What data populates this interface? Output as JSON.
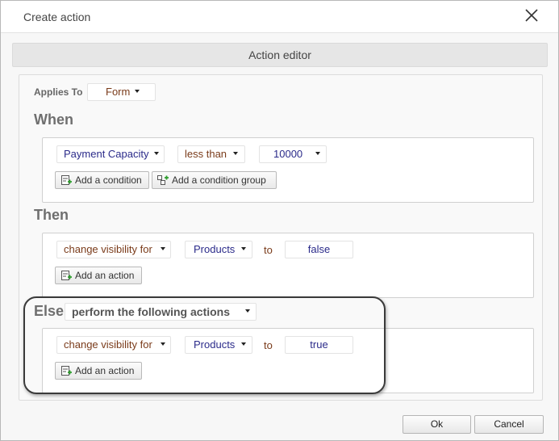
{
  "window": {
    "title": "Create action"
  },
  "editor": {
    "header": "Action editor",
    "applies_to": {
      "label": "Applies To",
      "value": "Form"
    }
  },
  "when": {
    "title": "When",
    "condition": {
      "field": "Payment Capacity",
      "operator": "less than",
      "value": "10000"
    },
    "add_condition_label": "Add a condition",
    "add_condition_group_label": "Add a condition group"
  },
  "then": {
    "title": "Then",
    "action": {
      "type": "change visibility for",
      "target": "Products",
      "to_label": "to",
      "value": "false"
    },
    "add_action_label": "Add an action"
  },
  "else": {
    "title": "Else",
    "mode": "perform the following actions",
    "action": {
      "type": "change visibility for",
      "target": "Products",
      "to_label": "to",
      "value": "true"
    },
    "add_action_label": "Add an action"
  },
  "footer": {
    "ok_label": "Ok",
    "cancel_label": "Cancel"
  },
  "icons": {
    "close": "close-icon",
    "add_condition": "add-condition-icon",
    "add_condition_group": "add-condition-group-icon",
    "add_action": "add-action-icon"
  },
  "colors": {
    "field_text": "#2b2b8a",
    "operator_text": "#7a3b1a",
    "section_title": "#6f6f6f",
    "header_bg": "#e6e6e6"
  }
}
